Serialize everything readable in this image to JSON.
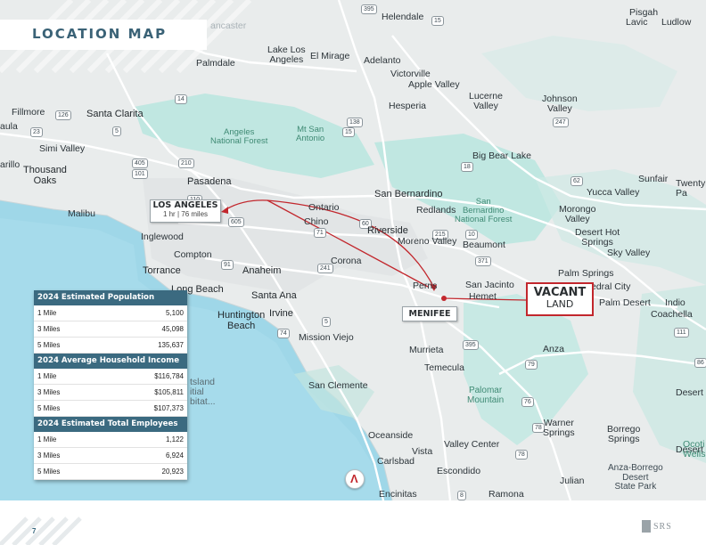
{
  "page": {
    "title": "LOCATION MAP",
    "page_number": "7",
    "logo_text": "SRS"
  },
  "callouts": {
    "los_angeles": {
      "name": "LOS ANGELES",
      "distance": "1 hr | 76 miles"
    },
    "menifee": {
      "name": "MENIFEE"
    },
    "vacant": {
      "line1": "VACANT",
      "line2": "LAND"
    }
  },
  "map_labels": {
    "helendale": "Helendale",
    "pisgah": "Pisgah",
    "lavic": "Lavic",
    "ludlow": "Ludlow",
    "palmdale": "Palmdale",
    "lake_los_angeles": "Lake Los\nAngeles",
    "el_mirage": "El Mirage",
    "adelanto": "Adelanto",
    "victorville": "Victorville",
    "apple_valley": "Apple Valley",
    "lucerne_valley": "Lucerne\nValley",
    "johnson_valley": "Johnson\nValley",
    "hesperia": "Hesperia",
    "fillmore": "Fillmore",
    "santa_clarita": "Santa Clarita",
    "paula": "aula",
    "angeles_nf": "Angeles\nNational Forest",
    "mt_san_antonio": "Mt San\nAntonio",
    "simi_valley": "Simi Valley",
    "thousand_oaks": "Thousand\nOaks",
    "marillo": "arillo",
    "big_bear_lake": "Big Bear Lake",
    "pasadena": "Pasadena",
    "sunfair": "Sunfair",
    "twentynine": "Twentyn\nPa",
    "yucca_valley": "Yucca Valley",
    "malibu": "Malibu",
    "san_bernardino": "San Bernardino",
    "ontario": "Ontario",
    "redlands": "Redlands",
    "san_bernardino_nf": "San\nBernardino\nNational Forest",
    "chino": "Chino",
    "morongo_valley": "Morongo\nValley",
    "riverside": "Riverside",
    "inglewood": "Inglewood",
    "moreno_valley": "Moreno Valley",
    "beaumont": "Beaumont",
    "desert_hot_springs": "Desert Hot\nSprings",
    "compton": "Compton",
    "corona": "Corona",
    "sky_valley": "Sky Valley",
    "torrance": "Torrance",
    "anaheim": "Anaheim",
    "palm_springs": "Palm Springs",
    "perris": "Perris",
    "san_jacinto": "San Jacinto",
    "hemet": "Hemet",
    "cathedral_city": "edral City",
    "long_beach": "Long Beach",
    "santa_ana": "Santa Ana",
    "palm_desert": "Palm Desert",
    "indio": "Indio",
    "huntington_beach": "Huntington\nBeach",
    "irvine": "Irvine",
    "coachella": "Coachella",
    "mission_viejo": "Mission Viejo",
    "murrieta": "Murrieta",
    "anza": "Anza",
    "temecula": "Temecula",
    "santa_catalina": "tsland\nitial\nbitat...",
    "san_clemente": "San Clemente",
    "palomar_mountain": "Palomar\nMountain",
    "desert_sh_1": "Desert Sh",
    "warner_springs": "Warner\nSprings",
    "borrego_springs": "Borrego\nSprings",
    "oceanside": "Oceanside",
    "vista": "Vista",
    "carlsbad": "Carlsbad",
    "valley_center": "Valley Center",
    "desert_sh_2": "Desert S",
    "ocotillo_wells": "Ocoti\nWells",
    "escondido": "Escondido",
    "julian": "Julian",
    "anza_borrego": "Anza-Borrego\nDesert\nState Park",
    "encinitas": "Encinitas",
    "ramona": "Ramona",
    "lancaster": "ancaster"
  },
  "highways": [
    "395",
    "15",
    "247",
    "14",
    "138",
    "18",
    "126",
    "5",
    "23",
    "210",
    "405",
    "101",
    "215",
    "10",
    "60",
    "110",
    "605",
    "71",
    "91",
    "241",
    "5",
    "74",
    "79",
    "371",
    "79",
    "76",
    "78",
    "78",
    "8",
    "395",
    "62",
    "111",
    "86",
    "15"
  ],
  "stats": {
    "population": {
      "header": "2024 Estimated Population",
      "rows": [
        {
          "label": "1 Mile",
          "value": "5,100"
        },
        {
          "label": "3 Miles",
          "value": "45,098"
        },
        {
          "label": "5 Miles",
          "value": "135,637"
        }
      ]
    },
    "income": {
      "header": "2024 Average Household Income",
      "rows": [
        {
          "label": "1 Mile",
          "value": "$116,784"
        },
        {
          "label": "3 Miles",
          "value": "$105,811"
        },
        {
          "label": "5 Miles",
          "value": "$107,373"
        }
      ]
    },
    "employees": {
      "header": "2024 Estimated Total Employees",
      "rows": [
        {
          "label": "1 Mile",
          "value": "1,122"
        },
        {
          "label": "3 Miles",
          "value": "6,924"
        },
        {
          "label": "5 Miles",
          "value": "20,923"
        }
      ]
    }
  },
  "colors": {
    "brand": "#3b6a80",
    "route": "#c2272d",
    "water": "#9fd7e8",
    "land": "#e9ecec",
    "forest": "#b8e6df"
  }
}
